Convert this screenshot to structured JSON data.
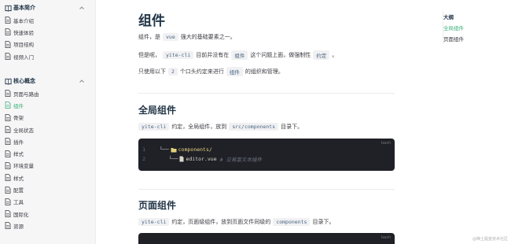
{
  "sidebar": {
    "groups": [
      {
        "title": "基本简介",
        "items": [
          "基本介绍",
          "快速体验",
          "项目结构",
          "视频入门"
        ]
      },
      {
        "title": "核心概念",
        "items": [
          "页面与路由",
          "组件",
          "骨架",
          "全局状态",
          "插件",
          "样式",
          "环境变量",
          "样式",
          "配置",
          "工具",
          "国际化",
          "资源"
        ]
      }
    ],
    "active_item": "组件"
  },
  "main": {
    "title": "组件",
    "p1": {
      "a": "组件，是",
      "code": "vue",
      "b": "强大的基础要素之一。"
    },
    "p2": {
      "a": "但是呢，",
      "code1": "yite-cli",
      "b": "目前并没有在",
      "code2": "组件",
      "c": "这个问题上面，做强制性",
      "code3": "约定",
      "d": "。"
    },
    "p3": {
      "a": "只使用以下",
      "code1": "2",
      "b": "个口头约定来进行",
      "code2": "组件",
      "c": "的组织和管理。"
    },
    "section1": {
      "heading": "全局组件",
      "para": {
        "code1": "yite-cli",
        "a": "约定，全局组件，放到",
        "code2": "src/components",
        "b": "目录下。"
      },
      "code": {
        "lang": "bash",
        "lines": [
          {
            "n": "1",
            "tree": "└──",
            "icon": "folder",
            "name": "components/",
            "comment": ""
          },
          {
            "n": "2",
            "tree": "   └──",
            "icon": "file",
            "name": "editor.vue",
            "comment": "# 交易富文本插件"
          }
        ]
      }
    },
    "section2": {
      "heading": "页面组件",
      "para": {
        "code1": "yite-cli",
        "a": "约定，页面级组件，放到页面文件同级的",
        "code2": "components",
        "b": "目录下。"
      },
      "code": {
        "lang": "bash"
      }
    }
  },
  "outline": {
    "title": "大纲",
    "links": [
      "全局组件",
      "页面组件"
    ],
    "active": "全局组件"
  },
  "watermark": "@稀土掘金技术社区",
  "colors": {
    "accent": "#3eaf7c",
    "code_bg": "#202127",
    "sidebar_bg": "#f6f6f7"
  }
}
